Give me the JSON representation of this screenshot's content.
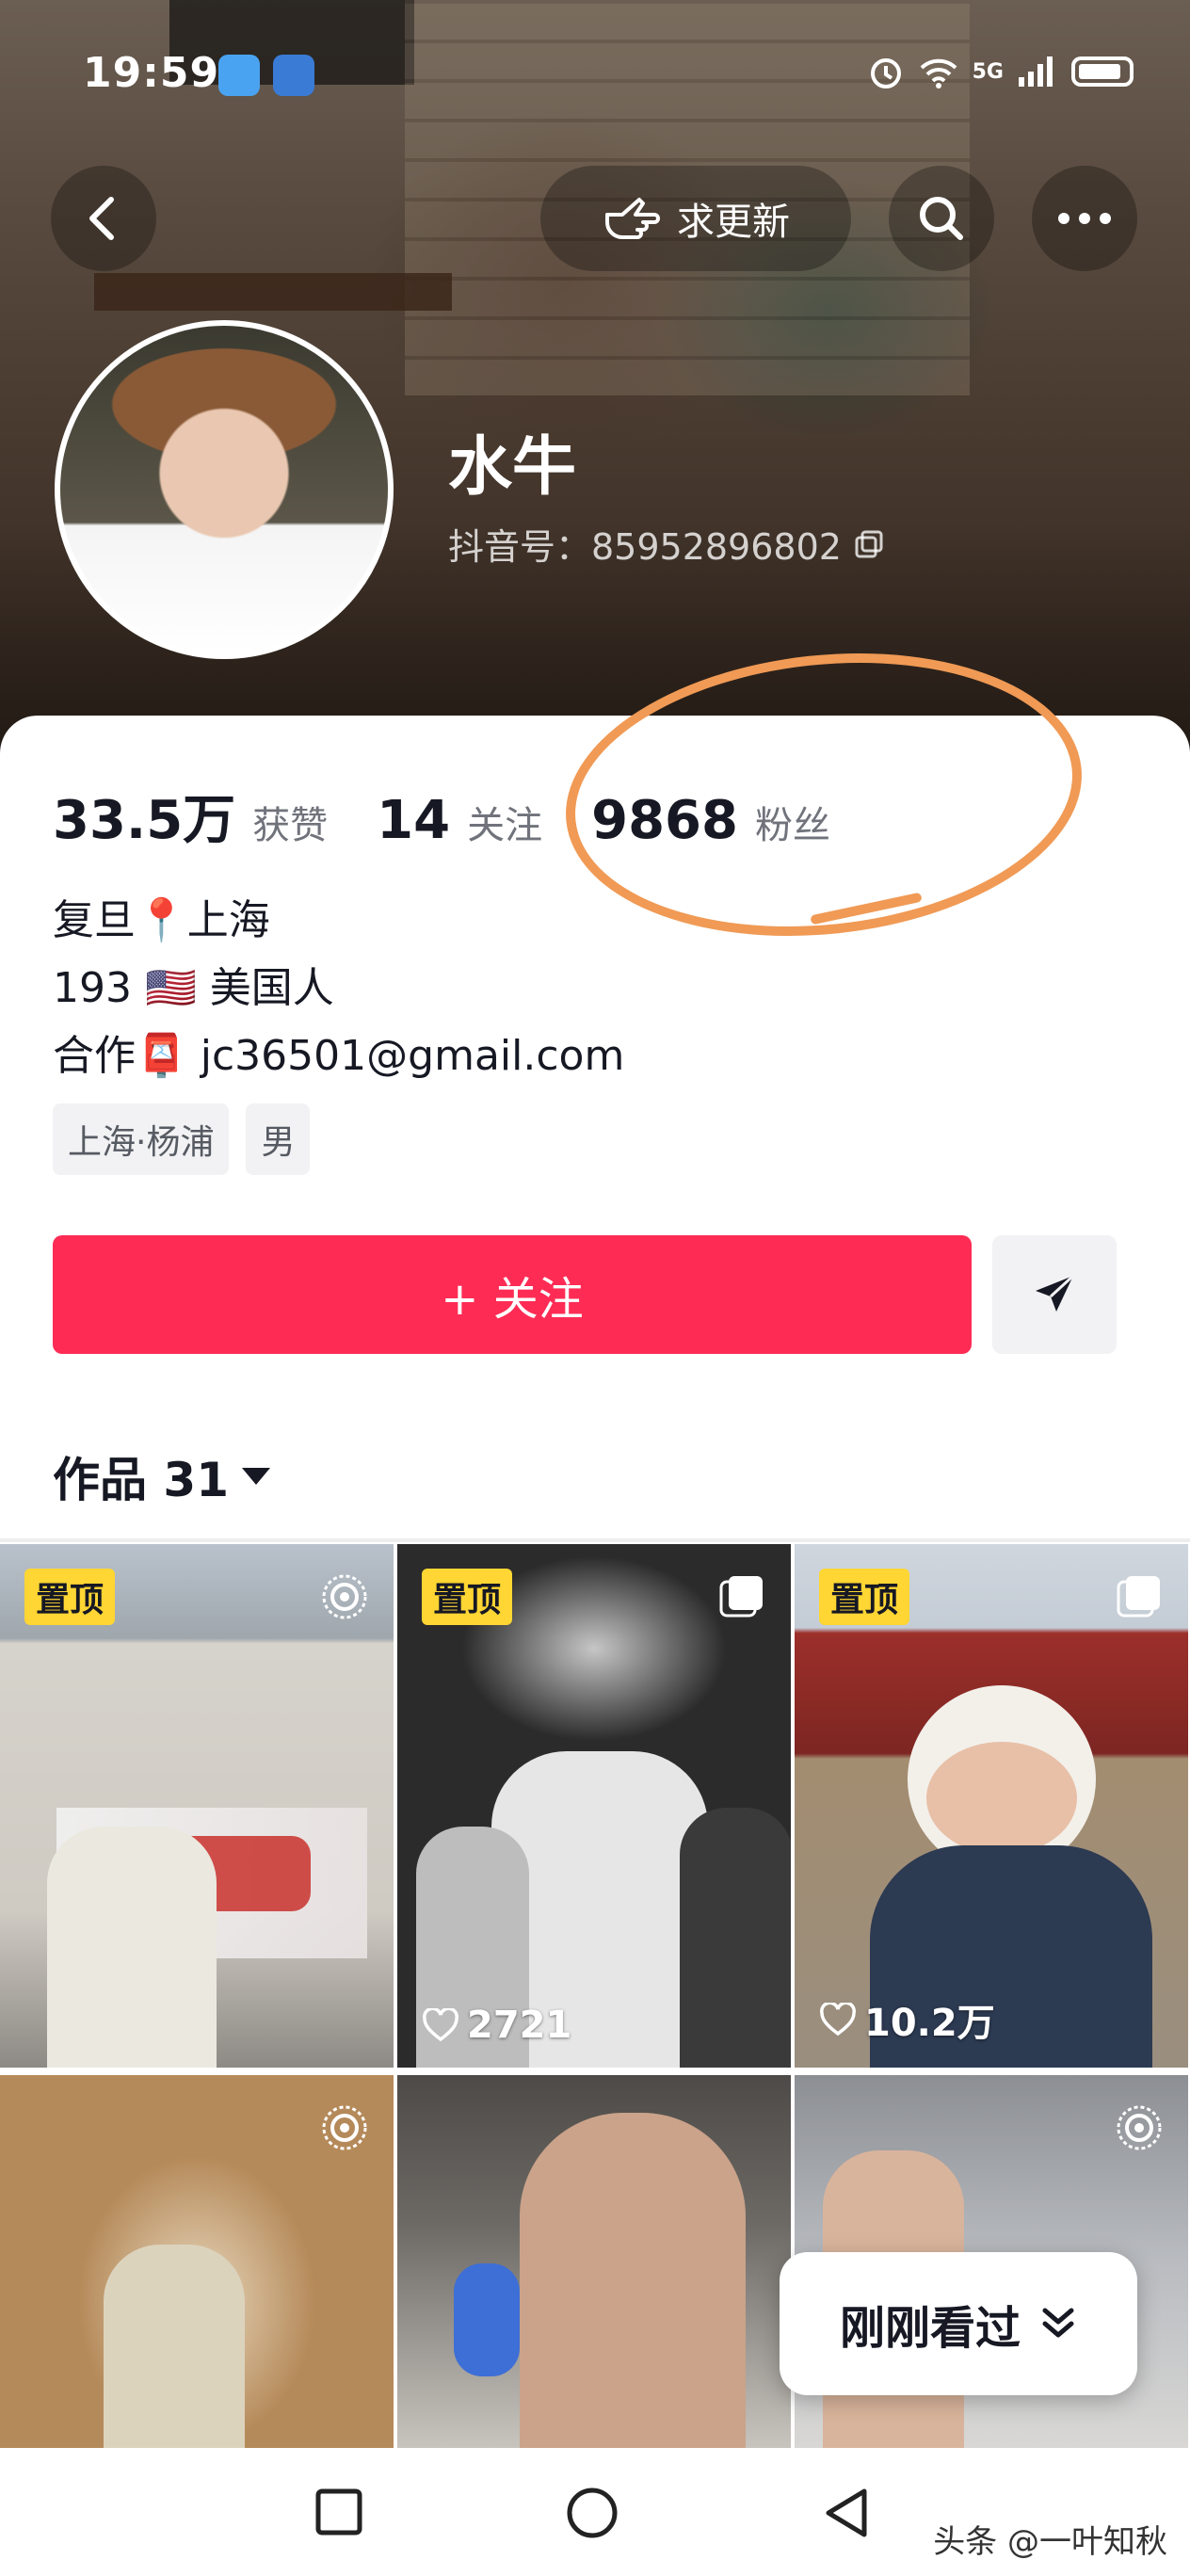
{
  "status_bar": {
    "time": "19:59",
    "network": "5G"
  },
  "header": {
    "request_update_label": "求更新"
  },
  "profile": {
    "name": "水牛",
    "douyin_id": "抖音号：85952896802"
  },
  "stats": {
    "likes_count": "33.5万",
    "likes_label": "获赞",
    "following_count": "14",
    "following_label": "关注",
    "followers_count": "9868",
    "followers_label": "粉丝"
  },
  "bio": {
    "line1": "复旦📍上海",
    "line2": "193 🇺🇸 美国人",
    "line3": "合作📮 jc36501@gmail.com"
  },
  "tags": [
    "上海·杨浦",
    "男"
  ],
  "actions": {
    "follow_label": "+ 关注"
  },
  "works": {
    "label": "作品 31"
  },
  "videos": [
    {
      "pinned_label": "置顶",
      "likes": ""
    },
    {
      "pinned_label": "置顶",
      "likes": "2721"
    },
    {
      "pinned_label": "置顶",
      "likes": "10.2万"
    }
  ],
  "recent": {
    "label": "刚刚看过"
  },
  "watermark": "头条 @一叶知秋",
  "colors": {
    "accent": "#fe2c55",
    "pin": "#ffd633",
    "annotation": "#f09a55"
  }
}
